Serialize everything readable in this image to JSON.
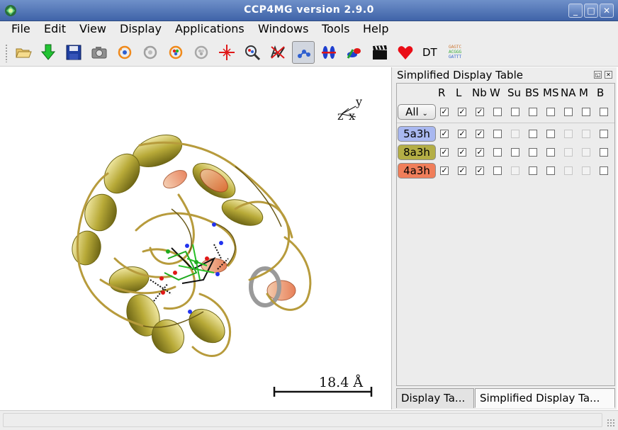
{
  "window": {
    "title": "CCP4MG version 2.9.0",
    "controls": [
      "_",
      "□",
      "✕"
    ]
  },
  "menu": [
    "File",
    "Edit",
    "View",
    "Display",
    "Applications",
    "Windows",
    "Tools",
    "Help"
  ],
  "toolbar": {
    "icons": [
      "open-folder-icon",
      "download-arrow-icon",
      "save-disk-icon",
      "camera-icon",
      "rotate-orange-icon",
      "rotate-grey-icon",
      "rotate-multicolor-icon",
      "rotate-multicolor-grey-icon",
      "center-crosshair-icon",
      "zoom-magnifier-icon",
      "no-atoms-icon",
      "picked-atoms-icon",
      "symmetry-bars-icon",
      "molecule-paint-icon",
      "movie-clapper-icon",
      "heart-icon"
    ],
    "dt_label": "DT",
    "sequence_icon_lines": [
      "GAGTC",
      "ACGGG",
      "GATTT"
    ],
    "pressed_index": 11
  },
  "viewport": {
    "axes": {
      "y": "y",
      "x": "x",
      "z": "z"
    },
    "scale_label": "18.4 Å"
  },
  "dock": {
    "title": "Simplified Display Table",
    "columns": [
      "R",
      "L",
      "Nb",
      "W",
      "Su",
      "BS",
      "MS",
      "NA",
      "M",
      "B"
    ],
    "all_row": {
      "label": "All",
      "has_dropdown": true,
      "checked": [
        true,
        true,
        true,
        false,
        false,
        false,
        false,
        false,
        false,
        false
      ]
    },
    "rows": [
      {
        "label": "5a3h",
        "color": "#a9b8f0",
        "checked": [
          true,
          true,
          true,
          false,
          false,
          false,
          false,
          false,
          false,
          false
        ],
        "disabled": [
          false,
          false,
          false,
          false,
          true,
          false,
          false,
          true,
          true,
          false
        ]
      },
      {
        "label": "8a3h",
        "color": "#b4ae45",
        "checked": [
          true,
          true,
          true,
          false,
          false,
          false,
          false,
          false,
          false,
          false
        ],
        "disabled": [
          false,
          false,
          false,
          false,
          false,
          false,
          false,
          true,
          true,
          false
        ]
      },
      {
        "label": "4a3h",
        "color": "#f07e5a",
        "checked": [
          true,
          true,
          true,
          false,
          false,
          false,
          false,
          false,
          false,
          false
        ],
        "disabled": [
          false,
          false,
          false,
          false,
          true,
          false,
          false,
          true,
          true,
          false
        ]
      }
    ],
    "tabs": [
      "Display Ta...",
      "Simplified Display Ta..."
    ],
    "active_tab": 1
  }
}
